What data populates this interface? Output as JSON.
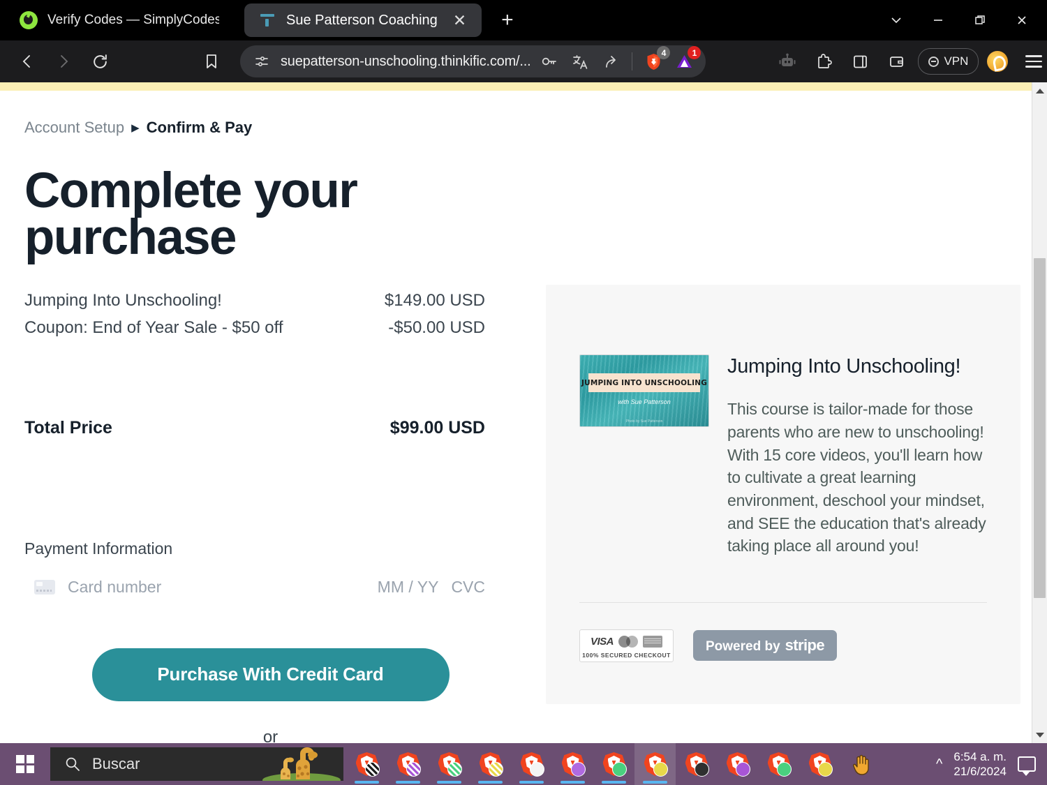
{
  "browser": {
    "tabs": [
      {
        "title": "Verify Codes — SimplyCodes",
        "favicon": "simplycodes-icon",
        "active": false
      },
      {
        "title": "Sue Patterson Coaching",
        "favicon": "thinkific-icon",
        "active": true
      }
    ],
    "new_tab_label": "+",
    "tab_close_label": "✕",
    "window_controls": {
      "tab_search": "chevron-down-icon",
      "minimize": "minimize-icon",
      "restore": "restore-icon",
      "close": "close-icon"
    },
    "toolbar": {
      "back": "back-arrow-icon",
      "forward": "forward-arrow-icon",
      "reload": "reload-icon",
      "bookmark": "bookmark-icon",
      "url": "suepatterson-unschooling.thinkific.com/...",
      "site_settings": "site-settings-icon",
      "password": "key-icon",
      "translate": "translate-icon",
      "share": "share-icon",
      "shield_badge": "4",
      "rewards_badge": "1",
      "robot": "robot-icon",
      "extensions": "extensions-icon",
      "sidebar": "sidebar-icon",
      "wallet": "wallet-icon",
      "vpn_label": "VPN",
      "brave_rewards": "brave-rewards-icon",
      "menu": "hamburger-menu-icon"
    }
  },
  "checkout": {
    "breadcrumb": {
      "previous": "Account Setup",
      "separator": "▶",
      "current": "Confirm & Pay"
    },
    "title": "Complete your purchase",
    "line_items": [
      {
        "label": "Jumping Into Unschooling!",
        "amount": "$149.00 USD"
      },
      {
        "label": "Coupon: End of Year Sale - $50 off",
        "amount": "-$50.00 USD"
      }
    ],
    "total": {
      "label": "Total Price",
      "amount": "$99.00 USD"
    },
    "payment_section_label": "Payment Information",
    "card_placeholder": "Card number",
    "expiry_placeholder": "MM / YY",
    "cvc_placeholder": "CVC",
    "purchase_button": "Purchase With Credit Card",
    "or_label": "or",
    "accent_color": "#2a9099"
  },
  "sidebar": {
    "product": {
      "title": "Jumping Into Unschooling!",
      "description": "This course is tailor-made for those parents who are new to unschooling! With 15 core videos, you'll learn how to cultivate a great learning environment, deschool your mindset, and SEE the education that's already taking place all around you!",
      "thumbnail": {
        "headline": "JUMPING INTO UNSCHOOLING",
        "subline": "with Sue Patterson",
        "credit": "Photo by Sue Patterson"
      }
    },
    "badges": {
      "visa": "VISA",
      "mastercard": "mastercard-icon",
      "amex": "amex-icon",
      "secured_text": "100% SECURED CHECKOUT",
      "stripe_prefix": "Powered by",
      "stripe_name": "stripe"
    }
  },
  "taskbar": {
    "start": "windows-start-icon",
    "search_placeholder": "Buscar",
    "apps": [
      {
        "name": "brave-window-1",
        "chip": "#2f2f2f",
        "active": false
      },
      {
        "name": "brave-window-2",
        "chip": "#a855d6",
        "active": false
      },
      {
        "name": "brave-window-3",
        "chip": "#4ad07f",
        "active": false
      },
      {
        "name": "brave-window-4",
        "chip": "#e8d84a",
        "active": false
      },
      {
        "name": "brave-window-5",
        "chip": "#f2f2f2",
        "active": false
      },
      {
        "name": "brave-window-6",
        "chip": "#b06ae0",
        "active": false
      },
      {
        "name": "brave-window-7",
        "chip": "#4ad07f",
        "active": false
      },
      {
        "name": "brave-window-8",
        "chip": "#e8d84a",
        "active": true
      },
      {
        "name": "brave-window-9",
        "chip": "#2f2f2f",
        "active": false
      },
      {
        "name": "brave-window-10",
        "chip": "#a855d6",
        "active": false
      },
      {
        "name": "brave-window-11",
        "chip": "#4ad07f",
        "active": false
      },
      {
        "name": "brave-window-12",
        "chip": "#e8d84a",
        "active": false
      }
    ],
    "cursor": "hand-cursor-icon",
    "tray_chevron": "^",
    "time": "6:54 a. m.",
    "date": "21/6/2024",
    "notifications": "notification-icon"
  }
}
